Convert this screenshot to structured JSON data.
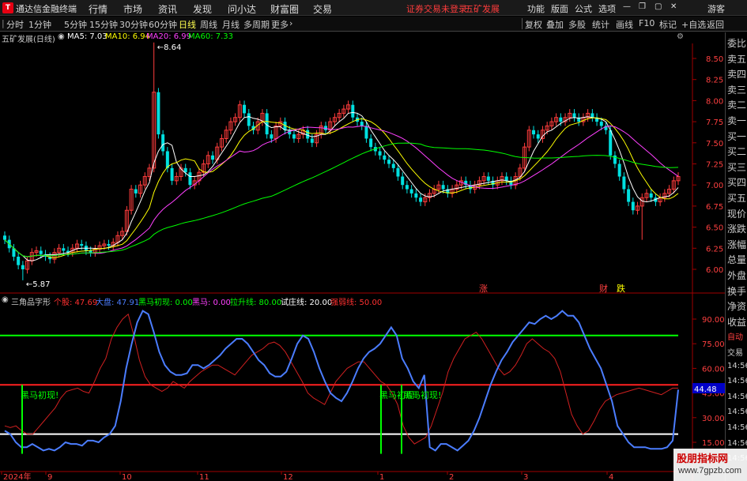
{
  "titlebar": {
    "app_name": "通达信金融终端",
    "menus": [
      "行情",
      "市场",
      "资讯",
      "发现",
      "问小达",
      "财富圈",
      "交易"
    ],
    "login_notice": "证券交易未登录",
    "stock_name": "五矿发展",
    "right_menus": [
      "功能",
      "版面",
      "公式",
      "选项"
    ],
    "guest": "游客"
  },
  "toolbar": {
    "periods": [
      "分时",
      "1分钟",
      "5分钟",
      "15分钟",
      "30分钟",
      "60分钟",
      "日线",
      "周线",
      "月线",
      "多周期",
      "更多"
    ],
    "active_period": "日线",
    "tools": [
      "复权",
      "叠加",
      "多股",
      "统计",
      "画线",
      "F10",
      "标记",
      "+自选",
      "返回"
    ]
  },
  "kline_header": {
    "title": "五矿发展(日线)",
    "ma5": "MA5: 7.03",
    "ma10": "MA10: 6.94",
    "ma20": "MA20: 6.99",
    "ma60": "MA60: 7.33"
  },
  "indicator_header": {
    "name": "三角品字形",
    "items": [
      {
        "label": "个股: 47.69",
        "color": "#ff3030"
      },
      {
        "label": "大盘: 47.91",
        "color": "#4b7dff"
      },
      {
        "label": "黑马初现: 0.00",
        "color": "#00ff00"
      },
      {
        "label": "黑马: 0.00",
        "color": "#ff40ff"
      },
      {
        "label": "拉升线: 80.00",
        "color": "#00ff00"
      },
      {
        "label": "试庄线: 20.00",
        "color": "#ffffff"
      },
      {
        "label": "强弱线: 50.00",
        "color": "#ff3030"
      }
    ]
  },
  "right_panel": {
    "labels": [
      "委比",
      "卖五",
      "卖四",
      "卖三",
      "卖二",
      "卖一",
      "买一",
      "买二",
      "买三",
      "买四",
      "买五",
      "现价",
      "涨跌",
      "涨幅",
      "总量",
      "外盘",
      "换手",
      "净资",
      "收益",
      "自动",
      "交易",
      "14:56",
      "14:56",
      "14:56",
      "14:56",
      "14:56",
      "14:56",
      "14:56"
    ]
  },
  "kline": {
    "price_ticks": [
      "8.50",
      "8.25",
      "8.00",
      "7.75",
      "7.50",
      "7.25",
      "7.00",
      "6.75",
      "6.50",
      "6.25",
      "6.00"
    ],
    "high_label": "8.64",
    "low_label": "5.87",
    "markers": [
      {
        "text": "涨",
        "color": "#ff4040"
      },
      {
        "text": "财",
        "color": "#ff4040"
      },
      {
        "text": "跌",
        "color": "#ffff00"
      }
    ],
    "colors": {
      "up": "#ff3c3c",
      "down": "#00e0e0",
      "ma5": "#ffffff",
      "ma10": "#ffff00",
      "ma20": "#ff40ff",
      "ma60": "#00ff00"
    }
  },
  "indicator": {
    "ticks": [
      "90.00",
      "75.00",
      "60.00",
      "45.00",
      "30.00",
      "15.00"
    ],
    "current_value": "44.48",
    "annotations": [
      "黑马初现!",
      "黑马初现!",
      "黑马初现!"
    ]
  },
  "time_axis": [
    "2024年",
    "9",
    "10",
    "11",
    "12",
    "1",
    "2",
    "3",
    "4"
  ],
  "watermark": {
    "cn": "股朋指标网",
    "url": "www.7gpzb.com"
  }
}
